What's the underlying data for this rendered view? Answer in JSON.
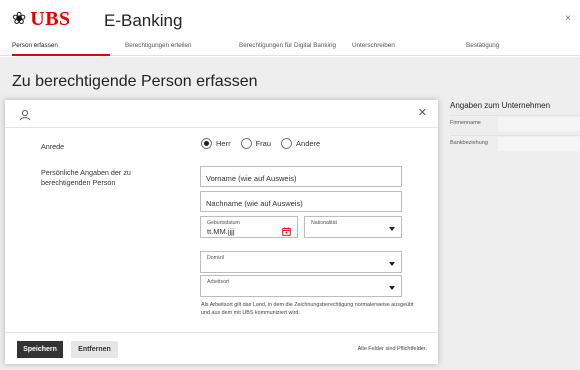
{
  "header": {
    "logo_keys": "❀",
    "logo_text": "UBS",
    "app_title": "E-Banking",
    "close_label": "×"
  },
  "steps": [
    {
      "label": "Person erfassen",
      "active": true
    },
    {
      "label": "Berechtigungen erteilen",
      "active": false
    },
    {
      "label": "Berechtigungen für Digital Banking",
      "active": false
    },
    {
      "label": "Unterschreiben",
      "active": false
    },
    {
      "label": "Bestätigung",
      "active": false
    }
  ],
  "page": {
    "title": "Zu berechtigende Person erfassen"
  },
  "company_panel": {
    "title": "Angaben zum Unternehmen",
    "rows": [
      {
        "label": "Firmenname",
        "value": ""
      },
      {
        "label": "Bankbeziehung",
        "value": ""
      }
    ]
  },
  "modal": {
    "close_label": "✕",
    "salutation": {
      "label": "Anrede",
      "options": [
        "Herr",
        "Frau",
        "Andere"
      ],
      "selected": "Herr"
    },
    "personal": {
      "label": "Persönliche Angaben der zu berechtigenden Person",
      "first_name_placeholder": "Vorname (wie auf Ausweis)",
      "last_name_placeholder": "Nachname (wie auf Ausweis)",
      "birthdate_label": "Geburtsdatum",
      "birthdate_placeholder": "tt.MM.jjjj",
      "nationality_label": "Nationalität",
      "domicile_label": "Domizil",
      "workplace_label": "Arbeitsort"
    },
    "hint": "Als Arbeitsort gilt das Land, in dem die Zeichnungsberechtigung normalerweise ausgeübt und aus dem mit UBS kommuniziert wird.",
    "footer": {
      "save_label": "Speichern",
      "remove_label": "Entfernen",
      "required_note": "Alle Felder sind Pflichtfelder."
    }
  },
  "colors": {
    "brand_red": "#e60000",
    "primary_button": "#333333",
    "secondary_button": "#e6e6e6",
    "page_background": "#eeeeee"
  }
}
